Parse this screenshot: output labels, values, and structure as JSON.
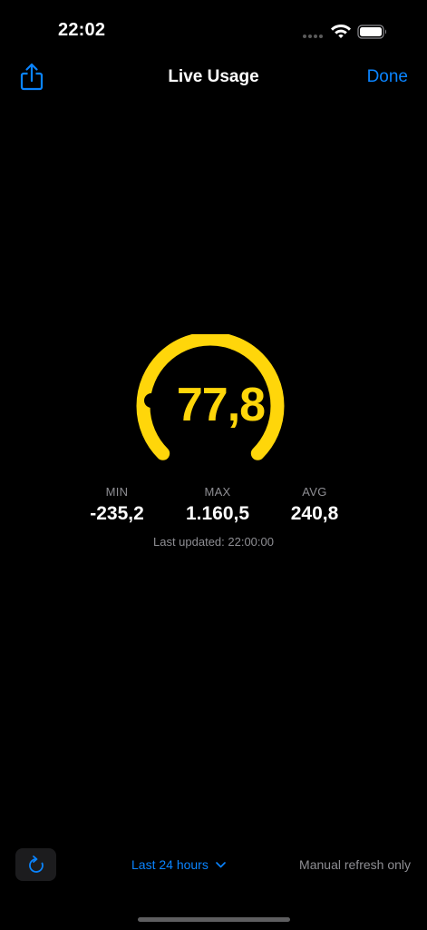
{
  "status_bar": {
    "time": "22:02",
    "icons": [
      "cellular-signal-icon",
      "wifi-icon",
      "battery-icon"
    ]
  },
  "nav": {
    "title": "Live Usage",
    "done_label": "Done",
    "share_icon": "share-icon"
  },
  "gauge": {
    "value": "77,8",
    "color": "#ffd60a",
    "level_fraction": 0.0
  },
  "stats": {
    "min_label": "MIN",
    "min_value": "-235,2",
    "max_label": "MAX",
    "max_value": "1.160,5",
    "avg_label": "AVG",
    "avg_value": "240,8"
  },
  "last_updated": "Last updated: 22:00:00",
  "toolbar": {
    "refresh_icon": "refresh-icon",
    "range_label": "Last 24 hours",
    "range_icon": "chevron-down-icon",
    "refresh_mode": "Manual refresh only"
  },
  "colors": {
    "accent": "#0a84ff",
    "gauge": "#ffd60a",
    "secondary_text": "#8e8e93",
    "background": "#000000"
  }
}
